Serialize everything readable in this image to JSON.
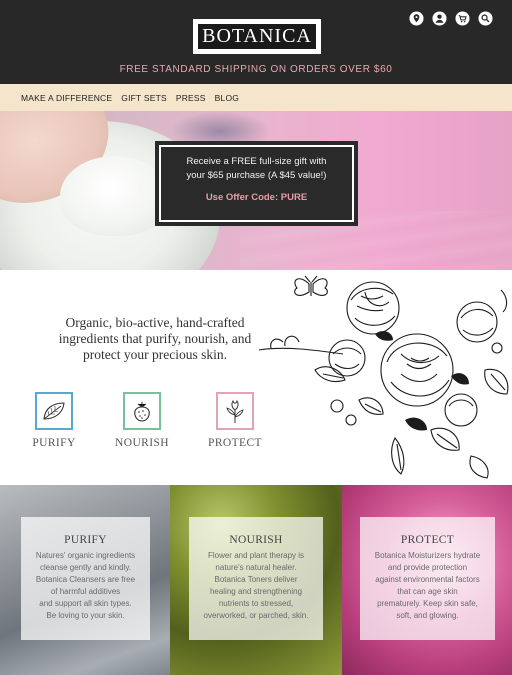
{
  "header": {
    "logo_text": "BOTANICA",
    "shipping_banner": "FREE STANDARD SHIPPING ON ORDERS OVER $60",
    "icons": [
      "location-pin-icon",
      "account-icon",
      "cart-icon",
      "search-icon"
    ]
  },
  "nav": {
    "items": [
      {
        "label": "MAKE A DIFFERENCE"
      },
      {
        "label": "GIFT SETS"
      },
      {
        "label": "PRESS"
      },
      {
        "label": "BLOG"
      }
    ]
  },
  "promo": {
    "line1": "Receive a FREE full-size gift with",
    "line2": "your $65 purchase (A $45 value!)",
    "code": "Use Offer Code: PURE"
  },
  "mission": {
    "line1": "Organic, bio-active, hand-crafted",
    "line2": "ingredients that purify, nourish, and",
    "line3": "protect your precious skin."
  },
  "pillars": [
    {
      "label": "PURIFY",
      "color": "#5aa8cf",
      "icon": "leaf-icon"
    },
    {
      "label": "NOURISH",
      "color": "#78c29a",
      "icon": "berry-icon"
    },
    {
      "label": "PROTECT",
      "color": "#e2a3b3",
      "icon": "flower-bud-icon"
    }
  ],
  "panels": [
    {
      "title": "PURIFY",
      "lines": [
        "Natures' organic ingredients",
        "cleanse gently and kindly.",
        "Botanica Cleansers are free",
        "of harmful additives",
        "and support all skin types.",
        "Be loving to your skin."
      ]
    },
    {
      "title": "NOURISH",
      "lines": [
        "Flower and plant therapy is",
        "nature's natural healer.",
        "Botanica Toners deliver",
        "healing and strengthening",
        "nutrients to stressed,",
        "overworked, or parched, skin."
      ]
    },
    {
      "title": "PROTECT",
      "lines": [
        "Botanica Moisturizers hydrate",
        "and provide protection",
        "against environmental factors",
        "that can age skin",
        "prematurely. Keep skin safe,",
        "soft, and glowing."
      ]
    }
  ],
  "colors": {
    "header_bg": "#282828",
    "banner_text": "#e9a7b0",
    "nav_bg": "#f4e5cb",
    "promo_code": "#e79ea8"
  }
}
